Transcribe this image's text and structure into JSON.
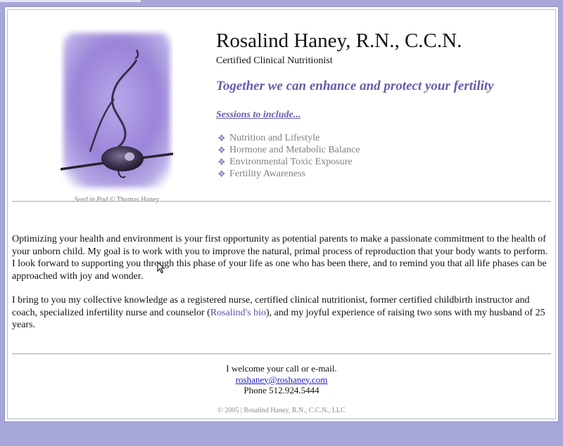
{
  "header": {
    "name": "Rosalind Haney, R.N., C.C.N.",
    "credential": "Certified Clinical Nutritionist",
    "tagline": "Together we can enhance and protect your fertility"
  },
  "photo": {
    "caption_title": "Seed in Pod",
    "caption_credit": "© Thomas Haney"
  },
  "sessions": {
    "link_label": "Sessions to include...",
    "bullet": "❖",
    "items": [
      "Nutrition and Lifestyle",
      "Hormone and Metabolic Balance",
      "Environmental Toxic Exposure",
      "Fertility Awareness"
    ]
  },
  "body": {
    "paragraph1": "Optimizing your health and environment is your first opportunity as potential parents to make a passionate commitment to the health of your unborn child. My goal is to work with you to improve the natural, primal process of reproduction that your body wants to perform. I look forward to supporting you through this phase of your life as one who has been there, and to remind you that all life phases can be approached with joy and wonder.",
    "paragraph2_before": "I bring to you my collective knowledge as a registered nurse, certified clinical nutritionist, former certified childbirth instructor and coach, specialized infertility nurse and counselor (",
    "bio_link": "Rosalind's bio",
    "paragraph2_after": "), and my joyful experience of raising two sons with my husband of 25 years."
  },
  "contact": {
    "welcome": "I welcome your call or e-mail.",
    "email": "roshaney@roshaney.com",
    "phone": "Phone 512.924.5444"
  },
  "footer": {
    "copyright": "© 2005 | Rosalind Haney, R.N., C.C.N., LLC"
  },
  "colors": {
    "page_background": "#a7a7d9",
    "accent_purple": "#6a5aab",
    "link_blue": "#1a1acc"
  }
}
